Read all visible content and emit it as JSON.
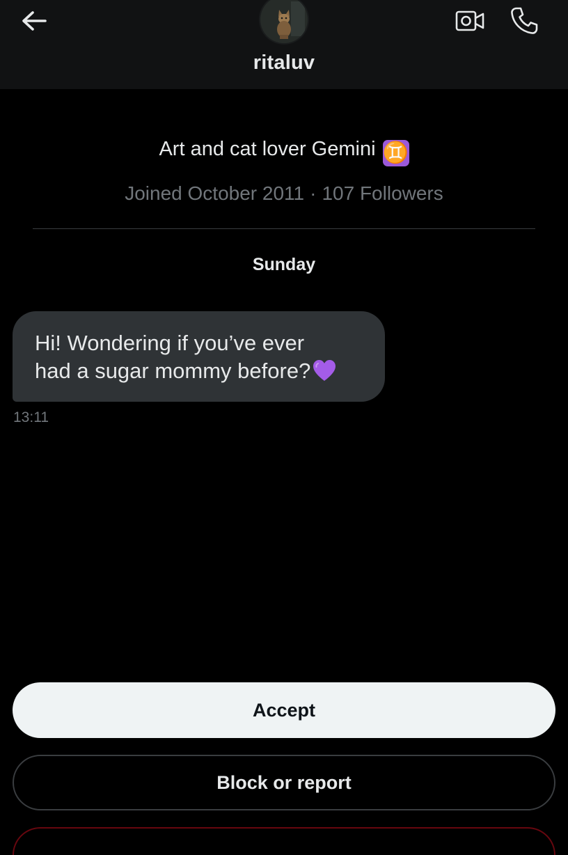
{
  "header": {
    "username": "ritaluv"
  },
  "profile": {
    "bio": "Art and cat lover Gemini",
    "bio_badge_symbol": "♊",
    "joined": "Joined October 2011",
    "separator": "·",
    "followers": "107 Followers"
  },
  "conversation": {
    "day_label": "Sunday",
    "messages": [
      {
        "text_line1": "Hi! Wondering if you’ve ever",
        "text_line2": "had a sugar mommy before?",
        "time": "13:11"
      }
    ]
  },
  "actions": {
    "accept_label": "Accept",
    "block_label": "Block or report"
  },
  "colors": {
    "background": "#000000",
    "header_background": "#111213",
    "bubble_background": "#2f3336",
    "muted_text": "#71767b",
    "accept_button": "#eff3f4",
    "heart_purple": "#a45ce8",
    "gemini_badge": "#9b59d9"
  },
  "icons": {
    "back": "arrow-left-icon",
    "video": "video-camera-icon",
    "call": "phone-icon",
    "heart": "purple-heart-icon",
    "zodiac": "gemini-icon"
  }
}
